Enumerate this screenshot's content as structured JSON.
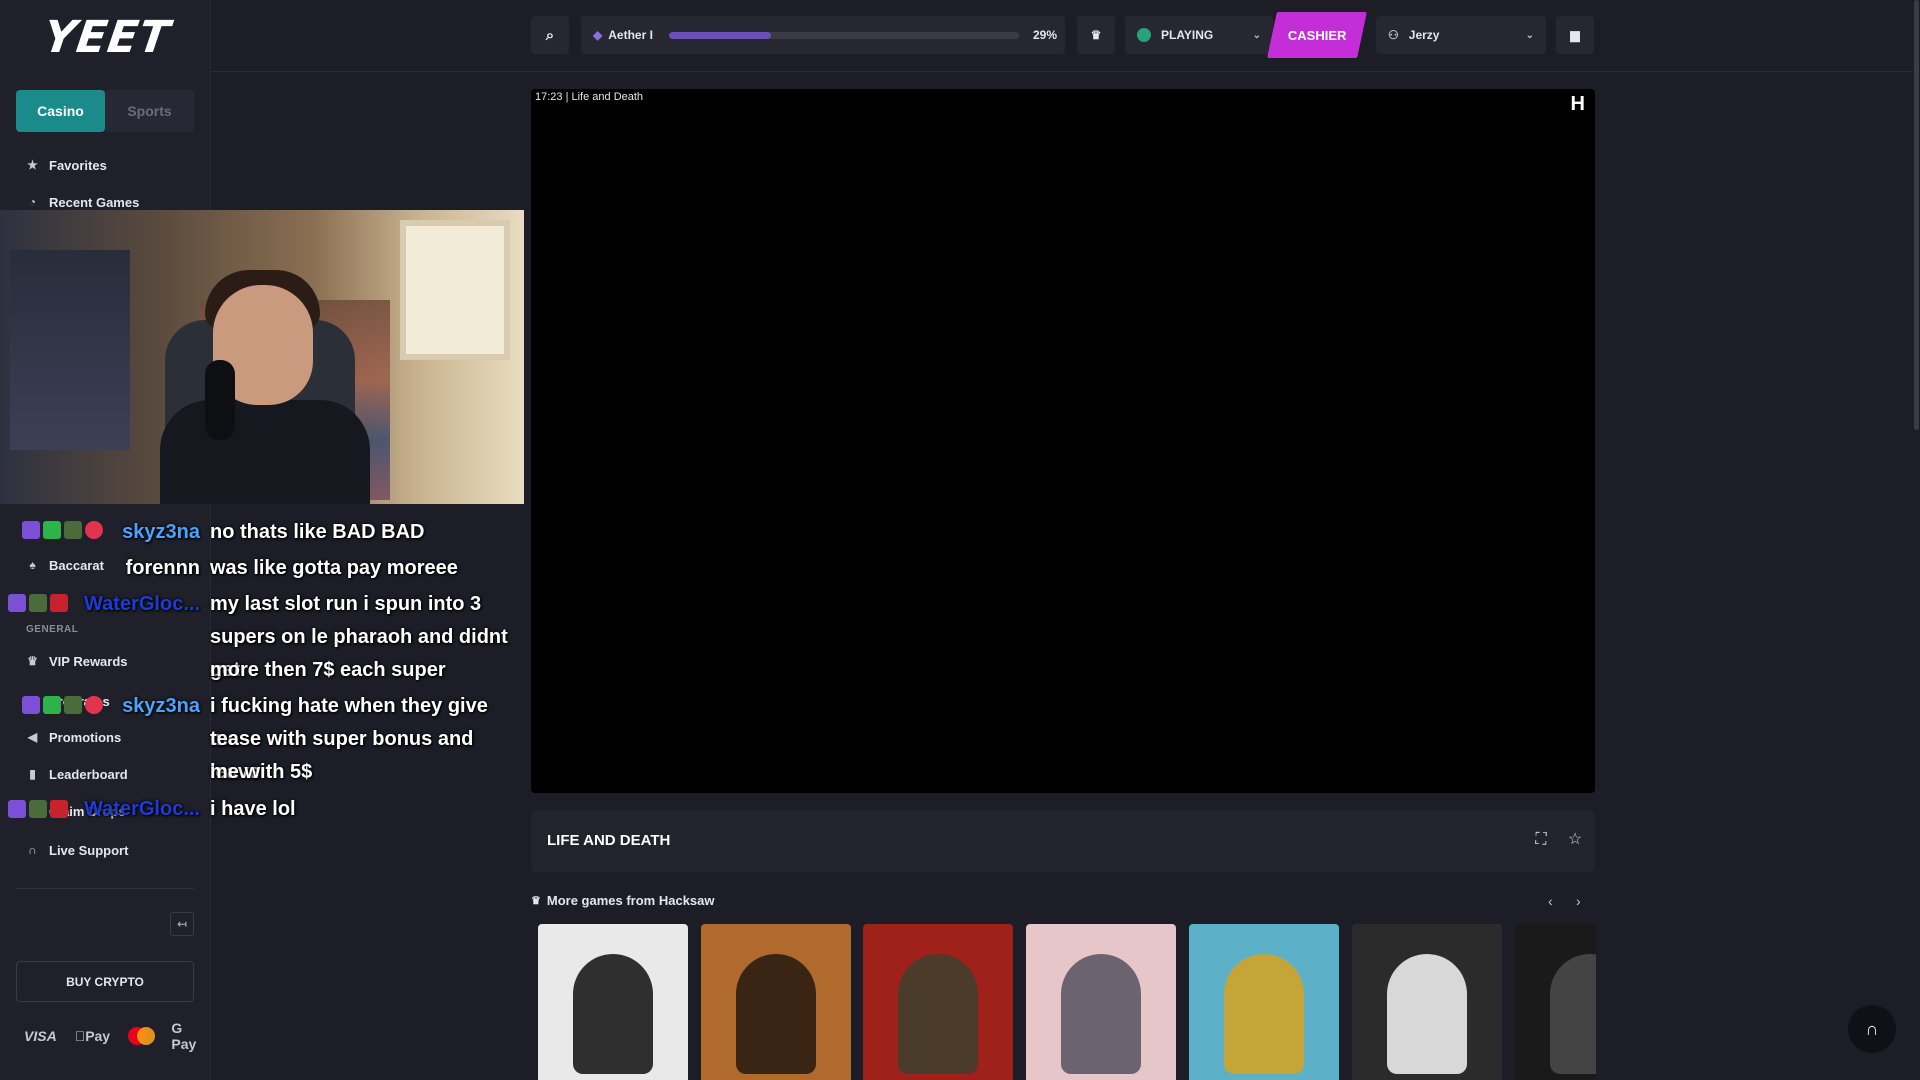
{
  "brand": {
    "logo_text": "YEET"
  },
  "sidebar": {
    "tabs": [
      {
        "label": "Casino",
        "active": true
      },
      {
        "label": "Sports",
        "active": false
      }
    ],
    "top_items": [
      {
        "label": "Favorites",
        "icon": "star-icon"
      },
      {
        "label": "Recent Games",
        "icon": "history-icon"
      }
    ],
    "section_label": "GENERAL",
    "general_items": [
      {
        "label": "Baccarat",
        "icon": "cards-icon"
      },
      {
        "label": "VIP Rewards",
        "icon": "crown-icon"
      },
      {
        "label": "Programs",
        "icon": "gift-icon"
      },
      {
        "label": "Promotions",
        "icon": "megaphone-icon"
      },
      {
        "label": "Leaderboard",
        "icon": "bar-chart-icon"
      },
      {
        "label": "Claim Drops",
        "icon": "drop-icon"
      },
      {
        "label": "Live Support",
        "icon": "headset-icon"
      }
    ],
    "buy_crypto_label": "BUY CRYPTO",
    "payment_methods": [
      "VISA",
      "Pay",
      "Mastercard",
      "G Pay"
    ]
  },
  "topbar": {
    "level_name": "Aether I",
    "level_progress_percent": 29,
    "level_progress_label": "29%",
    "playing_label": "PLAYING",
    "cashier_label": "CASHIER",
    "username": "Jerzy"
  },
  "game": {
    "frame_caption": "17:23 | Life and Death",
    "title": "LIFE AND DEATH",
    "provider_label": "More games from Hacksaw",
    "provider_mark": "H"
  },
  "chat": {
    "messages": [
      {
        "user": "skyz3na",
        "color": "#4aa3ff",
        "lines": [
          "no thats like BAD BAD"
        ]
      },
      {
        "user": "forennn",
        "color": "#ffffff",
        "lines": [
          "was like gotta pay moreee"
        ]
      },
      {
        "user": "WaterGloc...",
        "color": "#1f3bd6",
        "lines": [
          "my last slot run i spun into 3",
          "supers on le pharaoh and didnt get",
          "more then 7$ each super"
        ]
      },
      {
        "user": "skyz3na",
        "color": "#4aa3ff",
        "lines": [
          "i fucking hate when they give me",
          "tease with super bonus and leave",
          "me with 5$"
        ]
      },
      {
        "user": "WaterGloc...",
        "color": "#1f3bd6",
        "lines": [
          "i have lol"
        ]
      }
    ]
  },
  "colors": {
    "accent_teal": "#1b8a8a",
    "cashier_magenta": "#c32ed8",
    "progress_purple": "#6b4fbb",
    "background": "#1c1d26"
  },
  "thumbnails": [
    {
      "name": "green-cap-rat",
      "bg": "#e9e9ea",
      "fig": "#2f2f2f"
    },
    {
      "name": "cowboy",
      "bg": "#b06a2e",
      "fig": "#3a2414"
    },
    {
      "name": "gunslinger",
      "bg": "#a0201a",
      "fig": "#4b3b2a"
    },
    {
      "name": "raccoon",
      "bg": "#e7c6c9",
      "fig": "#6b6470"
    },
    {
      "name": "pharaoh-raccoon",
      "bg": "#5cb0c8",
      "fig": "#c5a438"
    },
    {
      "name": "devil",
      "bg": "#2b2b2b",
      "fig": "#d8d8d8"
    },
    {
      "name": "reaper",
      "bg": "#1a1a1a",
      "fig": "#444"
    }
  ]
}
